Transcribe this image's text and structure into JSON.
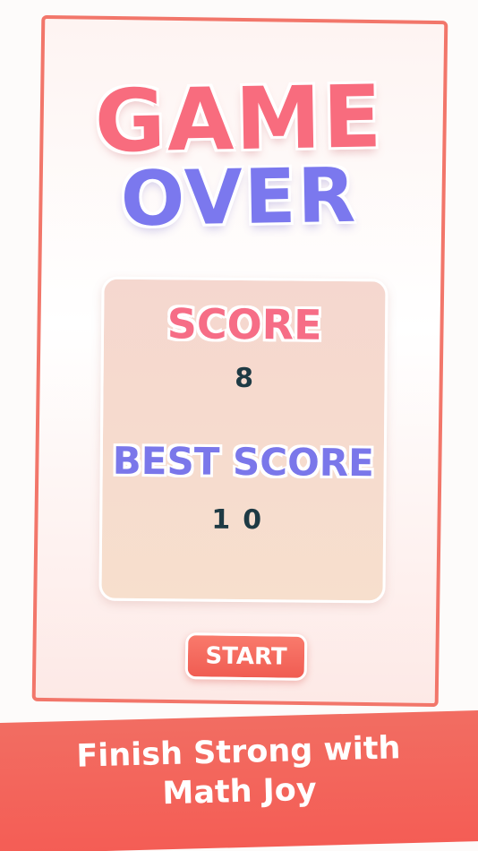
{
  "game_over": {
    "title_line1": "GAME",
    "title_line2": "OVER"
  },
  "score_panel": {
    "score_label": "SCORE",
    "score_value": "8",
    "best_label": "BEST SCORE",
    "best_value": "10"
  },
  "controls": {
    "start_label": "START"
  },
  "banner": {
    "line1": "Finish Strong with",
    "line2": "Math Joy"
  },
  "colors": {
    "accent_coral": "#f26d62",
    "title_pink": "#f86c7e",
    "title_purple": "#7b78ee",
    "value_dark": "#1e3a44"
  }
}
